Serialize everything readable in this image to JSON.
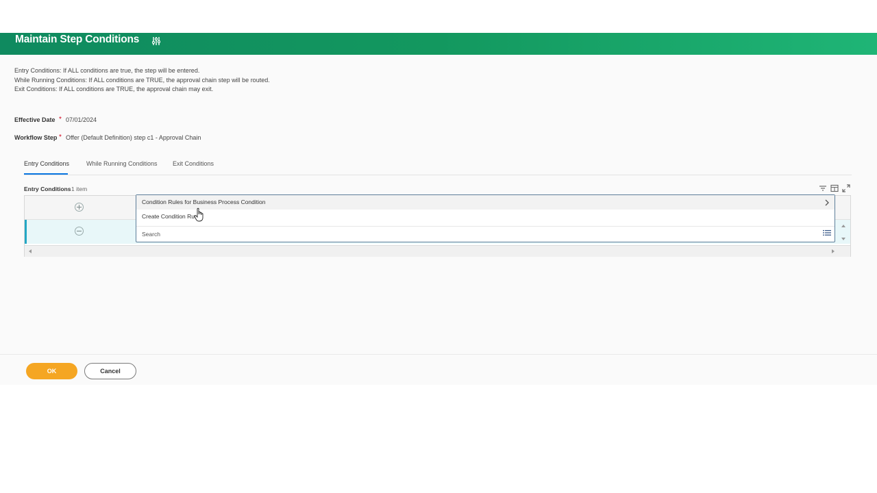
{
  "header": {
    "title": "Maintain Step Conditions",
    "icon": "related-actions-sliders-icon"
  },
  "info": {
    "line1": "Entry Conditions: If ALL conditions are true, the step will be entered.",
    "line2": "While Running Conditions: If ALL conditions are TRUE, the approval chain step will be routed.",
    "line3": "Exit Conditions:  If ALL conditions are TRUE, the approval chain may exit."
  },
  "fields": {
    "effective_date": {
      "label": "Effective Date",
      "required_mark": "*",
      "value": "07/01/2024"
    },
    "workflow_step": {
      "label": "Workflow Step",
      "required_mark": "*",
      "value": "Offer (Default Definition) step c1 - Approval Chain"
    }
  },
  "tabs": [
    {
      "label": "Entry Conditions",
      "active": true
    },
    {
      "label": "While Running Conditions",
      "active": false
    },
    {
      "label": "Exit Conditions",
      "active": false
    }
  ],
  "grid": {
    "title": "Entry Conditions",
    "count": "1 item",
    "tools": [
      "filter-icon",
      "column-chooser-icon",
      "expand-icon"
    ]
  },
  "dropdown": {
    "items": [
      {
        "label": "Condition Rules for Business Process Condition",
        "has_submenu": true
      },
      {
        "label": "Create Condition Ru"
      }
    ],
    "search_placeholder": "Search"
  },
  "actions": {
    "ok_label": "OK",
    "cancel_label": "Cancel"
  },
  "colors": {
    "header_start": "#0f8a5f",
    "header_end": "#1fb576",
    "ok_button": "#f5a623",
    "active_tab": "#0875e1",
    "selected_row_accent": "#23a7c4"
  }
}
